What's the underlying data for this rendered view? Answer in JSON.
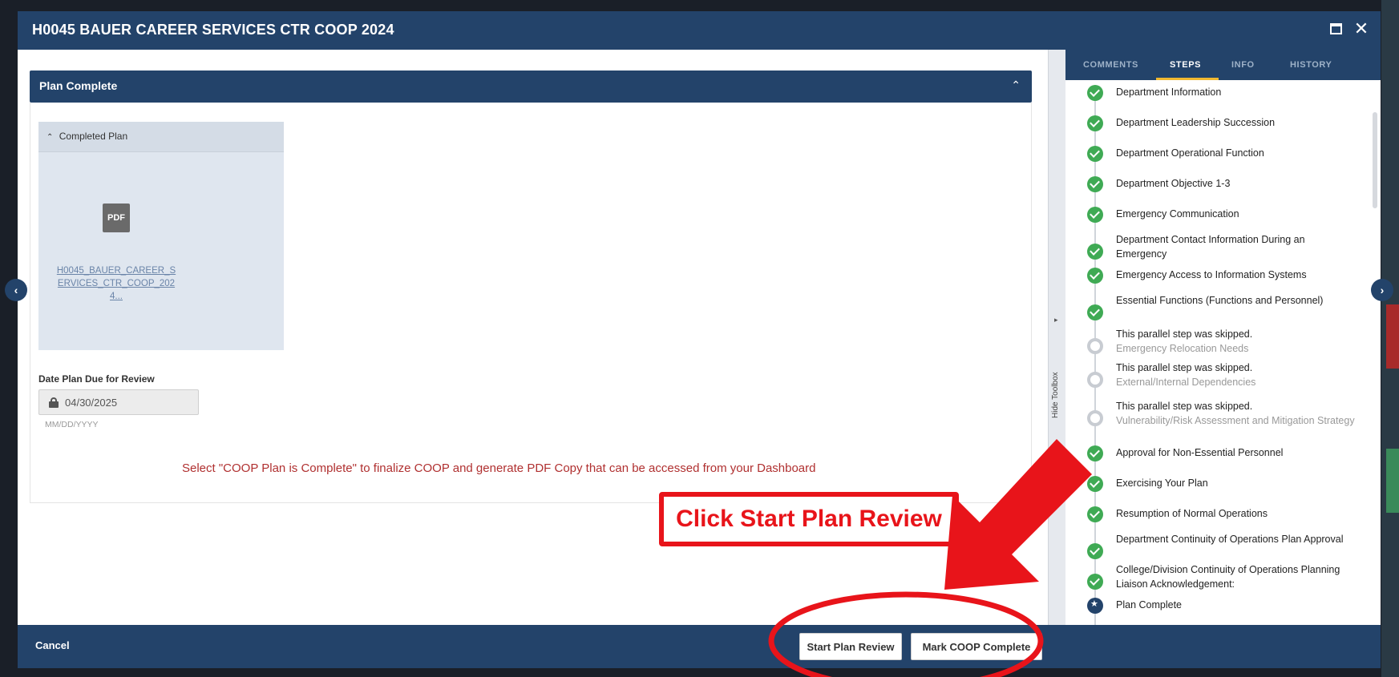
{
  "modal": {
    "title": "H0045 BAUER CAREER SERVICES CTR COOP 2024"
  },
  "section": {
    "title": "Plan Complete"
  },
  "completed_plan": {
    "heading": "Completed Plan",
    "file_type": "PDF",
    "file_link": "H0045_BAUER_CAREER_SERVICES_CTR_COOP_2024..."
  },
  "date_due": {
    "label": "Date Plan Due for Review",
    "value": "04/30/2025",
    "format_hint": "MM/DD/YYYY"
  },
  "instruction": "Select \"COOP Plan is Complete\" to finalize COOP and generate PDF Copy that can be accessed from your Dashboard",
  "callout": "Click Start Plan Review",
  "footer": {
    "cancel": "Cancel",
    "start_review": "Start Plan Review",
    "mark_complete": "Mark COOP Complete"
  },
  "toolbox": {
    "hide_label": "Hide Toolbox"
  },
  "sidebar": {
    "tabs": [
      "COMMENTS",
      "STEPS",
      "INFO",
      "HISTORY"
    ],
    "active_tab": "STEPS",
    "steps": [
      {
        "status": "done",
        "text": "Department Information"
      },
      {
        "status": "done",
        "text": "Department Leadership Succession"
      },
      {
        "status": "done",
        "text": "Department Operational Function"
      },
      {
        "status": "done",
        "text": "Department Objective 1-3"
      },
      {
        "status": "done",
        "text": "Emergency Communication"
      },
      {
        "status": "done",
        "text": "Department Contact Information During an Emergency"
      },
      {
        "status": "done",
        "text": "Emergency Access to Information Systems"
      },
      {
        "status": "done",
        "text": "Essential Functions (Functions and Personnel)"
      },
      {
        "status": "skipped",
        "text": "This parallel step was skipped.",
        "sub": "Emergency Relocation Needs"
      },
      {
        "status": "skipped",
        "text": "This parallel step was skipped.",
        "sub": "External/Internal Dependencies"
      },
      {
        "status": "skipped",
        "text": "This parallel step was skipped.",
        "sub": "Vulnerability/Risk Assessment and Mitigation Strategy"
      },
      {
        "status": "done",
        "text": "Approval for Non-Essential Personnel"
      },
      {
        "status": "done",
        "text": "Exercising Your Plan"
      },
      {
        "status": "done",
        "text": "Resumption of Normal Operations"
      },
      {
        "status": "done",
        "text": "Department Continuity of Operations Plan Approval"
      },
      {
        "status": "done",
        "text": "College/Division Continuity of Operations Planning Liaison Acknowledgement:"
      },
      {
        "status": "current",
        "text": "Plan Complete"
      }
    ]
  },
  "colors": {
    "navy": "#23436a",
    "step_done": "#3faa54",
    "annotation_red": "#e8141a",
    "instruction_red": "#b03030",
    "tab_accent": "#f0b830"
  },
  "icons": {
    "maximize": "maximize-icon",
    "close": "close-icon",
    "collapse": "chevron-up-icon",
    "lock": "lock-icon",
    "pdf": "pdf-icon",
    "nav_prev": "chevron-left-icon",
    "nav_next": "chevron-right-icon"
  }
}
